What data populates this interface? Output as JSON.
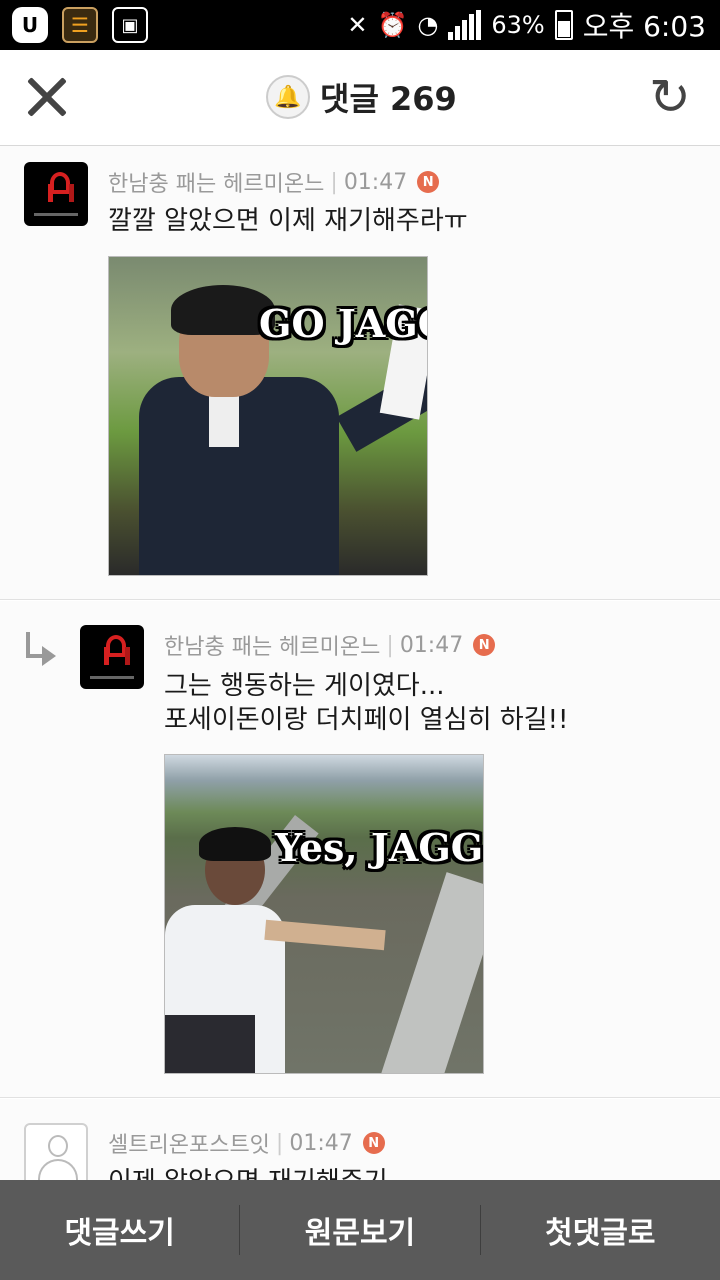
{
  "status_bar": {
    "battery": "63%",
    "time": "오후 6:03"
  },
  "header": {
    "title": "댓글 269"
  },
  "comments": [
    {
      "author": "한남충 패는 헤르미온느",
      "time": "01:47",
      "badge": "N",
      "text_lines": [
        "깔깔 알았으면 이제 재기해주라ㅠ"
      ],
      "image_caption": "GO JAGG"
    },
    {
      "author": "한남충 패는 헤르미온느",
      "time": "01:47",
      "badge": "N",
      "text_lines": [
        "그는 행동하는 게이였다...",
        "포세이돈이랑 더치페이 열심히 하길!!"
      ],
      "image_caption": "Yes, JAGG"
    },
    {
      "author": "셀트리온포스트잇",
      "time": "01:47",
      "badge": "N",
      "text_lines": [
        "이제 알았으면 재기해주기"
      ]
    }
  ],
  "bottom_bar": {
    "write": "댓글쓰기",
    "view_original": "원문보기",
    "first_comment": "첫댓글로"
  },
  "colors": {
    "badge": "#e66c4e",
    "bottom_bar": "#5a5a5a"
  }
}
